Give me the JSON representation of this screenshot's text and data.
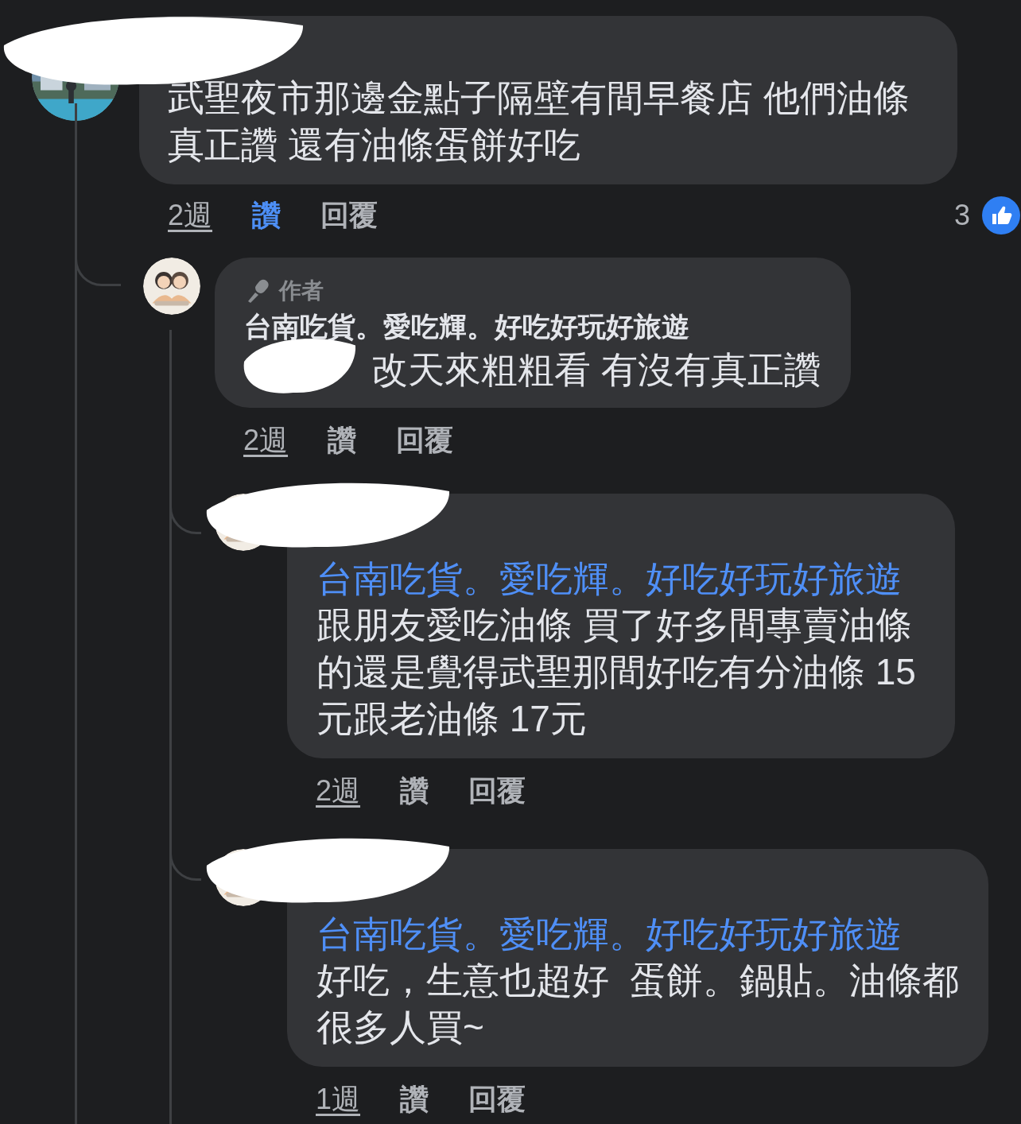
{
  "comments": [
    {
      "name_redacted": true,
      "text": "武聖夜市那邊金點子隔壁有間早餐店 他們油條真正讚 還有油條蛋餅好吃",
      "time": "2週",
      "like_label": "讚",
      "liked": true,
      "reply_label": "回覆",
      "reaction_count": "3",
      "replies": [
        {
          "badge": "作者",
          "name": "台南吃貨。愛吃輝。好吃好玩好旅遊",
          "mention_redacted": true,
          "text": "改天來粗粗看 有沒有真正讚",
          "time": "2週",
          "like_label": "讚",
          "liked": false,
          "reply_label": "回覆",
          "replies": [
            {
              "name_redacted": true,
              "mention": "台南吃貨。愛吃輝。好吃好玩好旅遊",
              "text": "跟朋友愛吃油條 買了好多間專賣油條的還是覺得武聖那間好吃有分油條 15元跟老油條 17元",
              "time": "2週",
              "like_label": "讚",
              "liked": false,
              "reply_label": "回覆"
            },
            {
              "name_redacted": true,
              "mention": "台南吃貨。愛吃輝。好吃好玩好旅遊",
              "text": "好吃，生意也超好  蛋餅。鍋貼。油條都很多人買~",
              "time": "1週",
              "like_label": "讚",
              "liked": false,
              "reply_label": "回覆"
            }
          ]
        }
      ]
    }
  ]
}
